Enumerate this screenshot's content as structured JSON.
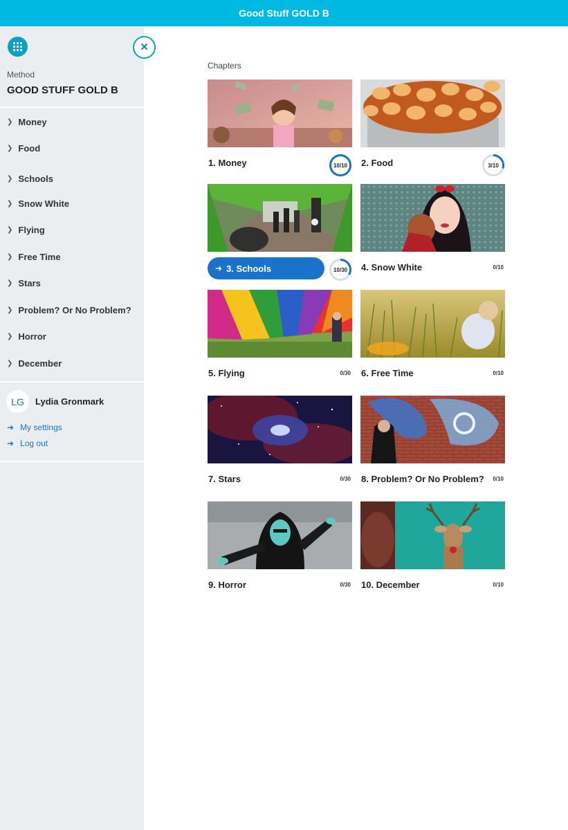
{
  "header": {
    "title": "Good Stuff GOLD B"
  },
  "sidebar": {
    "method_label": "Method",
    "method_name": "GOOD STUFF GOLD B",
    "items": [
      {
        "label": "Money"
      },
      {
        "label": "Food"
      },
      {
        "label": "Schools"
      },
      {
        "label": "Snow White"
      },
      {
        "label": "Flying"
      },
      {
        "label": "Free Time"
      },
      {
        "label": "Stars"
      },
      {
        "label": "Problem? Or No Problem?"
      },
      {
        "label": "Horror"
      },
      {
        "label": "December"
      }
    ],
    "user": {
      "initials": "LG",
      "name": "Lydia Gronmark"
    },
    "links": {
      "settings": "My settings",
      "logout": "Log out"
    },
    "icons": {
      "apps": "apps-grid-icon",
      "close": "close-icon",
      "chevron": "chevron-right-icon",
      "arrow": "arrow-right-icon"
    }
  },
  "main": {
    "chapters_label": "Chapters",
    "accent_color": "#1b72c9",
    "chapters": [
      {
        "title": "1. Money",
        "score": "10/10",
        "progress": 1.0
      },
      {
        "title": "2. Food",
        "score": "3/10",
        "progress": 0.3
      },
      {
        "title": "3. Schools",
        "score": "10/30",
        "progress": 0.33,
        "active": true
      },
      {
        "title": "4. Snow White",
        "score": "0/10"
      },
      {
        "title": "5. Flying",
        "score": "0/30"
      },
      {
        "title": "6. Free Time",
        "score": "0/10"
      },
      {
        "title": "7. Stars",
        "score": "0/30"
      },
      {
        "title": "8. Problem? Or No Problem?",
        "score": "0/10"
      },
      {
        "title": "9. Horror",
        "score": "0/30"
      },
      {
        "title": "10. December",
        "score": "0/10"
      }
    ]
  },
  "colors": {
    "header": "#00b9e2",
    "sidebar_bg": "#ebeef0",
    "accent": "#1b72c9",
    "teal": "#0aa1c4"
  }
}
